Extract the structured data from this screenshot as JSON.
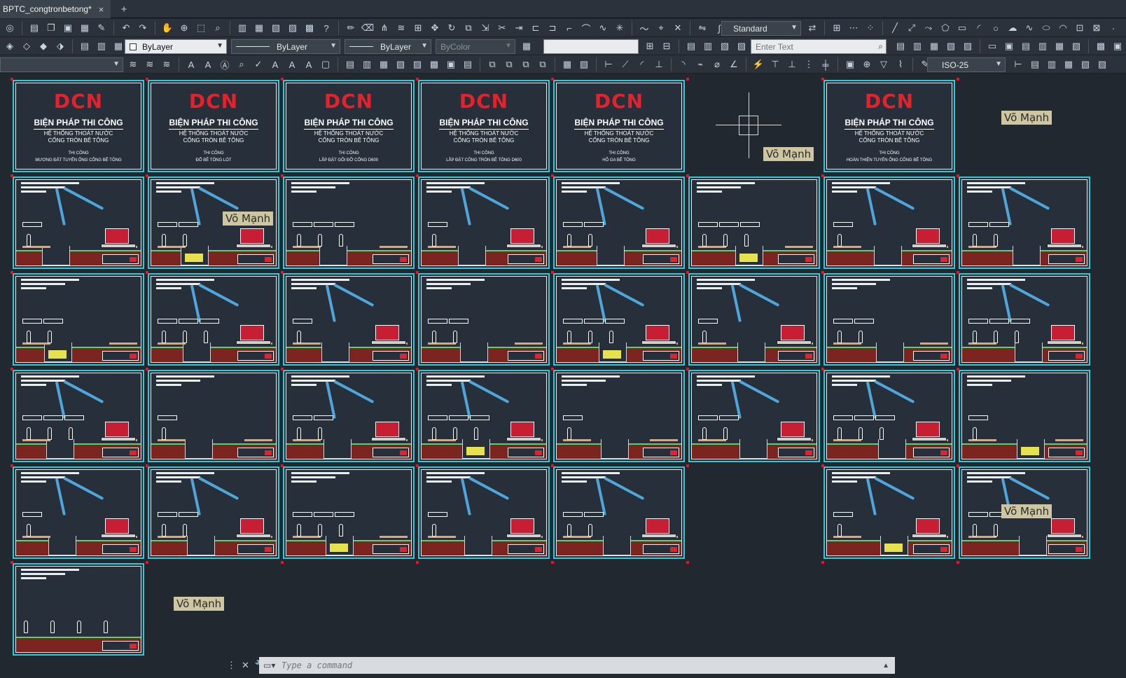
{
  "tab": {
    "title": "BPTC_congtronbetong*",
    "close": "×",
    "new": "+"
  },
  "toolbar": {
    "text_style": "Standard",
    "layer": "ByLayer",
    "linetype": "ByLayer",
    "lineweight": "ByLayer",
    "plot_style": "ByColor",
    "find_placeholder": "Enter Text",
    "dim_style": "ISO-25"
  },
  "cover": {
    "logo": "DCN",
    "title": "BIỆN PHÁP THI CÔNG",
    "subtitle_1": "HỆ THỐNG THOÁT NƯỚC",
    "subtitle_2": "CỐNG TRÒN BÊ TÔNG",
    "small": "THI CÔNG",
    "details": [
      "MƯƠNG ĐẤT TUYẾN ỐNG CỐNG BÊ TÔNG",
      "ĐỔ BÊ TÔNG LÓT",
      "LẮP ĐẶT GỐI ĐỠ CỐNG D600",
      "LẮP ĐẶT CỐNG TRÒN BÊ TÔNG D600",
      "HỐ GA BÊ TÔNG",
      "HOÀN THIỆN TUYẾN ỐNG CỐNG BÊ TÔNG"
    ]
  },
  "watermarks": [
    "Võ Mạnh",
    "Võ Mạnh",
    "Võ Mạnh",
    "Võ Mạnh",
    "Võ Mạnh"
  ],
  "command": {
    "placeholder": "Type a command"
  },
  "colors": {
    "sheet_border": "#36c6d4",
    "soil": "#7b2420",
    "grass": "#5fd16b",
    "excavator": "#c81e33",
    "boom": "#4ea6da",
    "logo": "#e4222c"
  }
}
